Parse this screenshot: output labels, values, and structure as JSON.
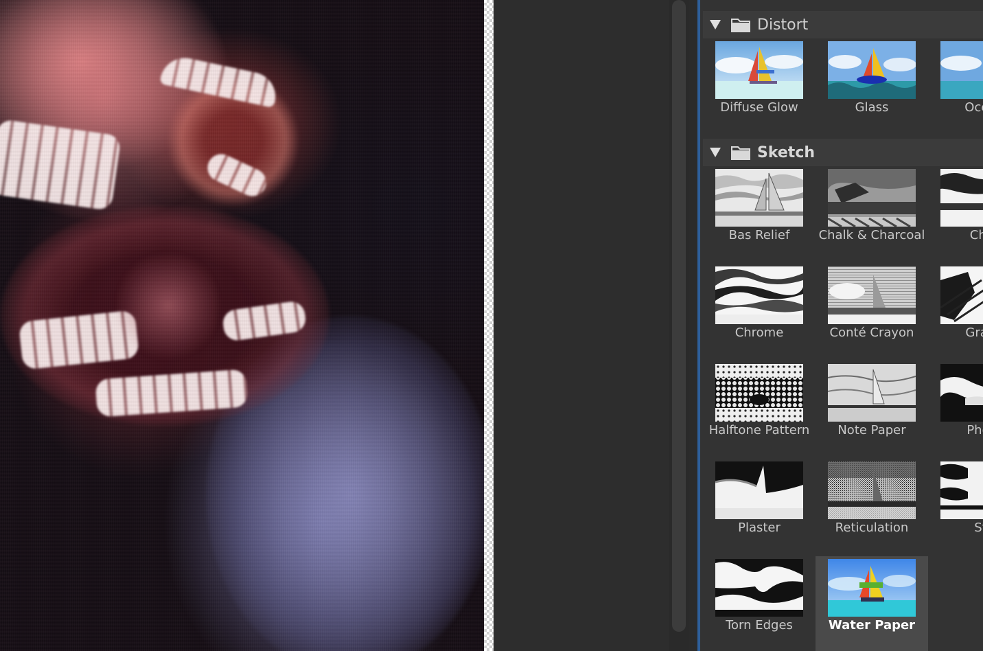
{
  "gallery": {
    "categories": [
      {
        "name": "Distort",
        "expanded": true,
        "filters": [
          "Diffuse Glow",
          "Glass",
          "Ocean"
        ]
      },
      {
        "name": "Sketch",
        "expanded": true,
        "filters": [
          "Bas Relief",
          "Chalk & Charcoal",
          "Char",
          "Chrome",
          "Conté Crayon",
          "Graph",
          "Halftone Pattern",
          "Note Paper",
          "Photo",
          "Plaster",
          "Reticulation",
          "Sta",
          "Torn Edges",
          "Water Paper"
        ]
      }
    ],
    "selected_filter": "Water Paper"
  },
  "icons": {
    "disclosure": "triangle-down-icon",
    "folder": "folder-icon"
  },
  "colors": {
    "panel_bg": "#333333",
    "header_bg": "#3b3b3b",
    "selected_bg": "#4a4a4a",
    "accent": "#2e5f9a"
  }
}
